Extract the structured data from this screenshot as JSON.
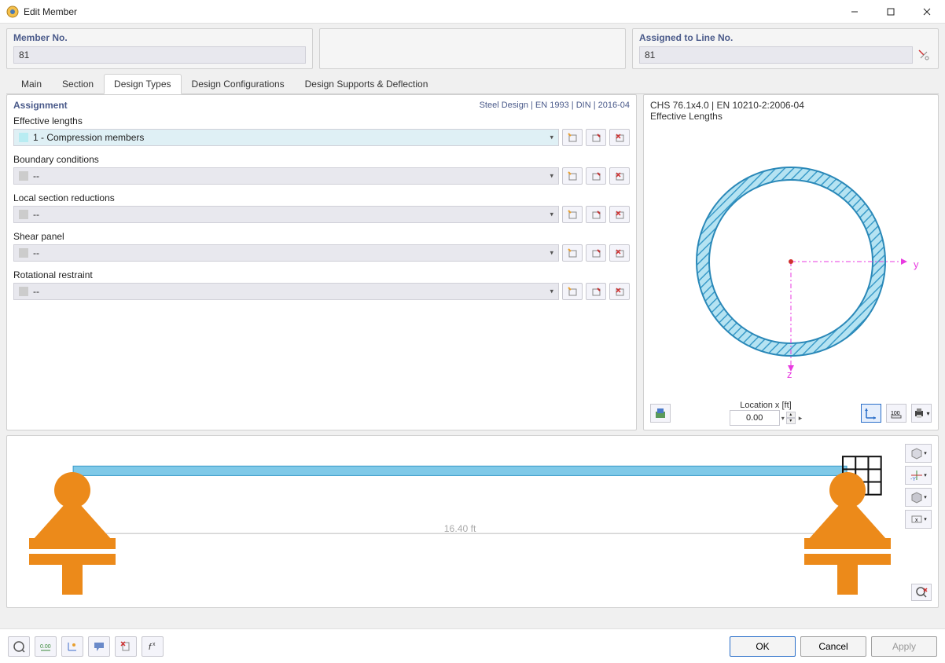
{
  "window": {
    "title": "Edit Member"
  },
  "header": {
    "member_no_label": "Member No.",
    "member_no_value": "81",
    "assigned_label": "Assigned to Line No.",
    "assigned_value": "81"
  },
  "tabs": {
    "main": "Main",
    "section": "Section",
    "design_types": "Design Types",
    "design_config": "Design Configurations",
    "design_supports": "Design Supports & Deflection"
  },
  "assignment": {
    "title": "Assignment",
    "standard": "Steel Design | EN 1993 | DIN | 2016-04",
    "fields": {
      "effective_lengths": {
        "label": "Effective lengths",
        "value": "1 - Compression members"
      },
      "boundary_conditions": {
        "label": "Boundary conditions",
        "value": "--"
      },
      "local_section_reductions": {
        "label": "Local section reductions",
        "value": "--"
      },
      "shear_panel": {
        "label": "Shear panel",
        "value": "--"
      },
      "rotational_restraint": {
        "label": "Rotational restraint",
        "value": "--"
      }
    }
  },
  "preview": {
    "section": "CHS 76.1x4.0 | EN 10210-2:2006-04",
    "subtitle": "Effective Lengths",
    "location_label": "Location x [ft]",
    "location_value": "0.00",
    "axis_y": "y",
    "axis_z": "z"
  },
  "span_view": {
    "length_label": "16.40 ft"
  },
  "buttons": {
    "ok": "OK",
    "cancel": "Cancel",
    "apply": "Apply"
  }
}
